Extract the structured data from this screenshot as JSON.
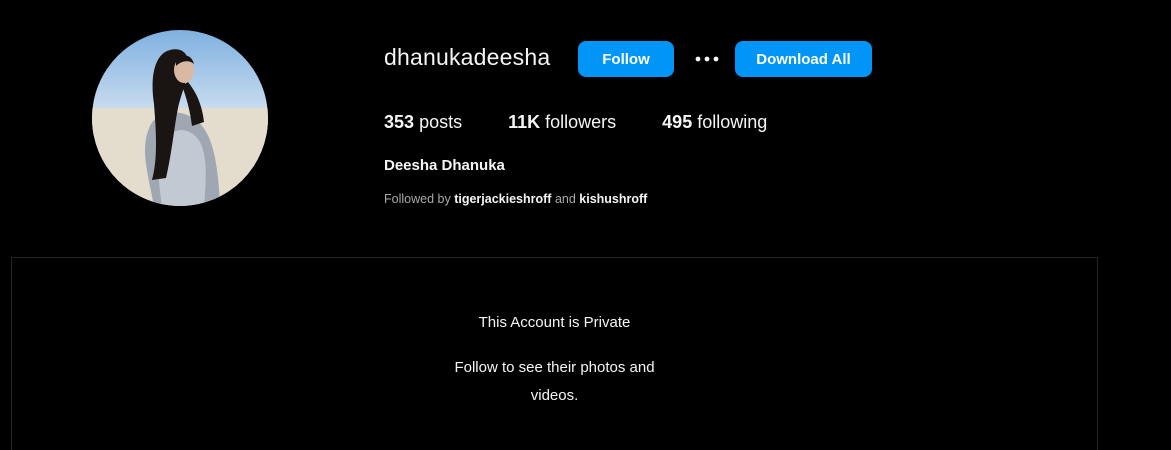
{
  "profile": {
    "username": "dhanukadeesha",
    "full_name": "Deesha Dhanuka",
    "avatar_icon": "profile-photo"
  },
  "actions": {
    "follow_label": "Follow",
    "more_icon": "more-options-icon",
    "download_label": "Download All"
  },
  "stats": {
    "posts": {
      "count": "353",
      "label": "posts"
    },
    "followers": {
      "count": "11K",
      "label": "followers"
    },
    "following": {
      "count": "495",
      "label": "following"
    }
  },
  "followed_by": {
    "prefix": "Followed by",
    "user1": "tigerjackieshroff",
    "conjunction": "and",
    "user2": "kishushroff"
  },
  "private": {
    "title": "This Account is Private",
    "subtitle": "Follow to see their photos and videos."
  },
  "colors": {
    "background": "#000000",
    "accent": "#0095f6",
    "text": "#f5f5f5",
    "muted": "#a8a8a8",
    "border": "#262626"
  }
}
